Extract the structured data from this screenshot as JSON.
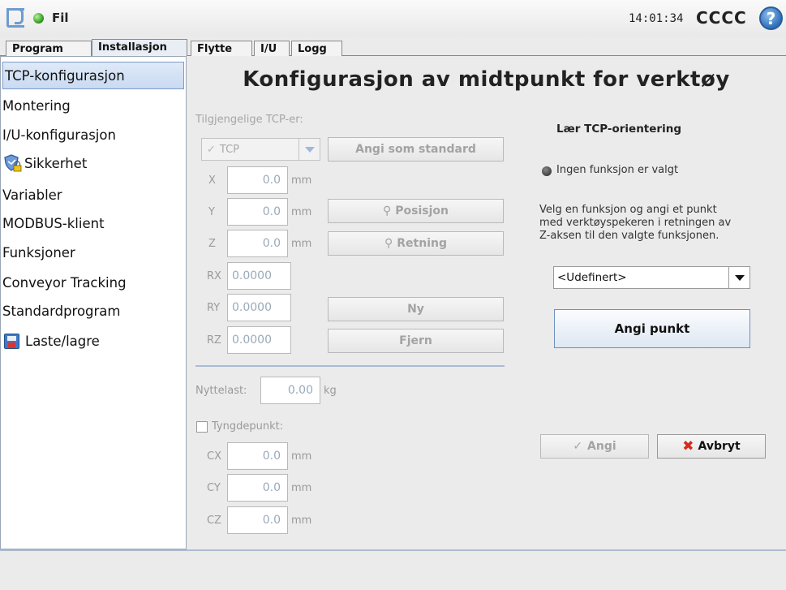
{
  "header": {
    "file_label": "Fil",
    "clock": "14:01:34",
    "robot_name": "CCCC",
    "help_symbol": "?"
  },
  "tabs": [
    {
      "label": "Program",
      "active": false
    },
    {
      "label": "Installasjon",
      "active": true
    },
    {
      "label": "Flytte",
      "active": false
    },
    {
      "label": "I/U",
      "active": false
    },
    {
      "label": "Logg",
      "active": false
    }
  ],
  "sidebar": {
    "items": [
      {
        "label": "TCP-konfigurasjon",
        "active": true,
        "icon": ""
      },
      {
        "label": "Montering",
        "icon": ""
      },
      {
        "label": "I/U-konfigurasjon",
        "icon": ""
      },
      {
        "label": "Sikkerhet",
        "icon": "shield-lock-icon"
      },
      {
        "label": "Variabler",
        "icon": ""
      },
      {
        "label": "MODBUS-klient",
        "icon": ""
      },
      {
        "label": "Funksjoner",
        "icon": ""
      },
      {
        "label": "Conveyor Tracking",
        "icon": ""
      },
      {
        "label": "Standardprogram",
        "icon": ""
      },
      {
        "label": "Laste/lagre",
        "icon": "disk-icon"
      }
    ]
  },
  "main": {
    "title": "Konfigurasjon av midtpunkt for verktøy",
    "available_tcps_label": "Tilgjengelige TCP-er:",
    "tcp_select": {
      "value": "TCP",
      "icon": "checkmark-icon"
    },
    "set_default_button": "Angi som standard",
    "coords": [
      {
        "label": "X",
        "value": "0.0",
        "unit": "mm"
      },
      {
        "label": "Y",
        "value": "0.0",
        "unit": "mm"
      },
      {
        "label": "Z",
        "value": "0.0",
        "unit": "mm"
      },
      {
        "label": "RX",
        "value": "0.0000"
      },
      {
        "label": "RY",
        "value": "0.0000"
      },
      {
        "label": "RZ",
        "value": "0.0000"
      }
    ],
    "position_button": "Posisjon",
    "direction_button": "Retning",
    "new_button": "Ny",
    "remove_button": "Fjern",
    "payload_label": "Nyttelast:",
    "payload_value": "0.00",
    "payload_unit": "kg",
    "cog_label": "Tyngdepunkt:",
    "cog": [
      {
        "label": "CX",
        "value": "0.0",
        "unit": "mm"
      },
      {
        "label": "CY",
        "value": "0.0",
        "unit": "mm"
      },
      {
        "label": "CZ",
        "value": "0.0",
        "unit": "mm"
      }
    ]
  },
  "teach": {
    "title": "Lær TCP-orientering",
    "status": "Ingen funksjon er valgt",
    "instructions_line1": "Velg en funksjon og angi et punkt",
    "instructions_line2": "med verktøyspekeren i retningen av",
    "instructions_line3": "Z-aksen til den valgte funksjonen.",
    "feature_select": "<Udefinert>",
    "set_point_button": "Angi punkt",
    "apply_button": "Angi",
    "cancel_button": "Avbryt"
  }
}
